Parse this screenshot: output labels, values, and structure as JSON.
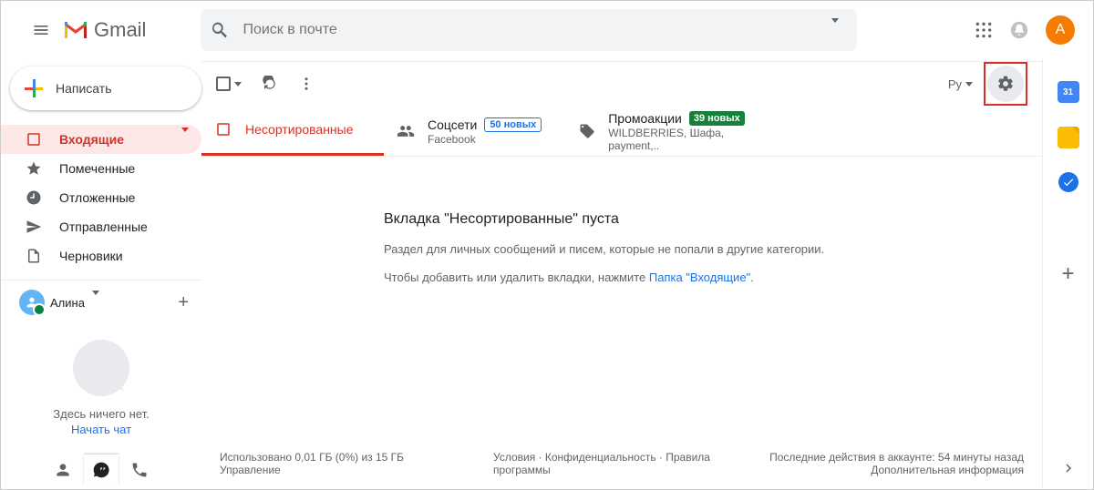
{
  "header": {
    "brand": "Gmail",
    "search_placeholder": "Поиск в почте",
    "avatar_initial": "А"
  },
  "sidebar": {
    "compose": "Написать",
    "items": [
      {
        "label": "Входящие"
      },
      {
        "label": "Помеченные"
      },
      {
        "label": "Отложенные"
      },
      {
        "label": "Отправленные"
      },
      {
        "label": "Черновики"
      }
    ],
    "hangouts_user": "Алина",
    "hangouts_empty": "Здесь ничего нет.",
    "hangouts_start": "Начать чат"
  },
  "toolbar": {
    "lang": "Ру"
  },
  "tabs": [
    {
      "label": "Несортированные",
      "sub": "",
      "badge": ""
    },
    {
      "label": "Соцсети",
      "sub": "Facebook",
      "badge": "50 новых",
      "badge_color": "blue"
    },
    {
      "label": "Промоакции",
      "sub": "WILDBERRIES, Шафа, payment,..",
      "badge": "39 новых",
      "badge_color": "green"
    }
  ],
  "empty": {
    "title": "Вкладка \"Несортированные\" пуста",
    "line1": "Раздел для личных сообщений и писем, которые не попали в другие категории.",
    "line2_a": "Чтобы добавить или удалить вкладки, нажмите ",
    "line2_link": "Папка \"Входящие\"",
    "line2_b": "."
  },
  "footer": {
    "storage1": "Использовано 0,01 ГБ (0%) из 15 ГБ",
    "storage2": "Управление",
    "mid": "Условия · Конфиденциальность · Правила программы",
    "right1": "Последние действия в аккаунте: 54 минуты назад",
    "right2": "Дополнительная информация"
  },
  "rightbar": {
    "calendar_day": "31"
  }
}
